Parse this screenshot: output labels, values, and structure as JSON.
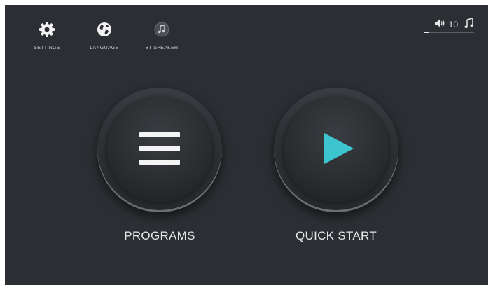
{
  "nav": [
    {
      "label": "SETTINGS",
      "icon": "gear-icon"
    },
    {
      "label": "LANGUAGE",
      "icon": "globe-icon"
    },
    {
      "label": "BT SPEAKER",
      "icon": "music-note-icon"
    }
  ],
  "volume": {
    "value": "10",
    "level": 0.1,
    "icons": [
      "speaker-icon",
      "music-note-icon"
    ]
  },
  "buttons": {
    "programs": "PROGRAMS",
    "quick_start": "QUICK START"
  },
  "colors": {
    "background": "#2b2e32",
    "play_accent": "#3cc4cf",
    "text": "#e4e6e8"
  }
}
